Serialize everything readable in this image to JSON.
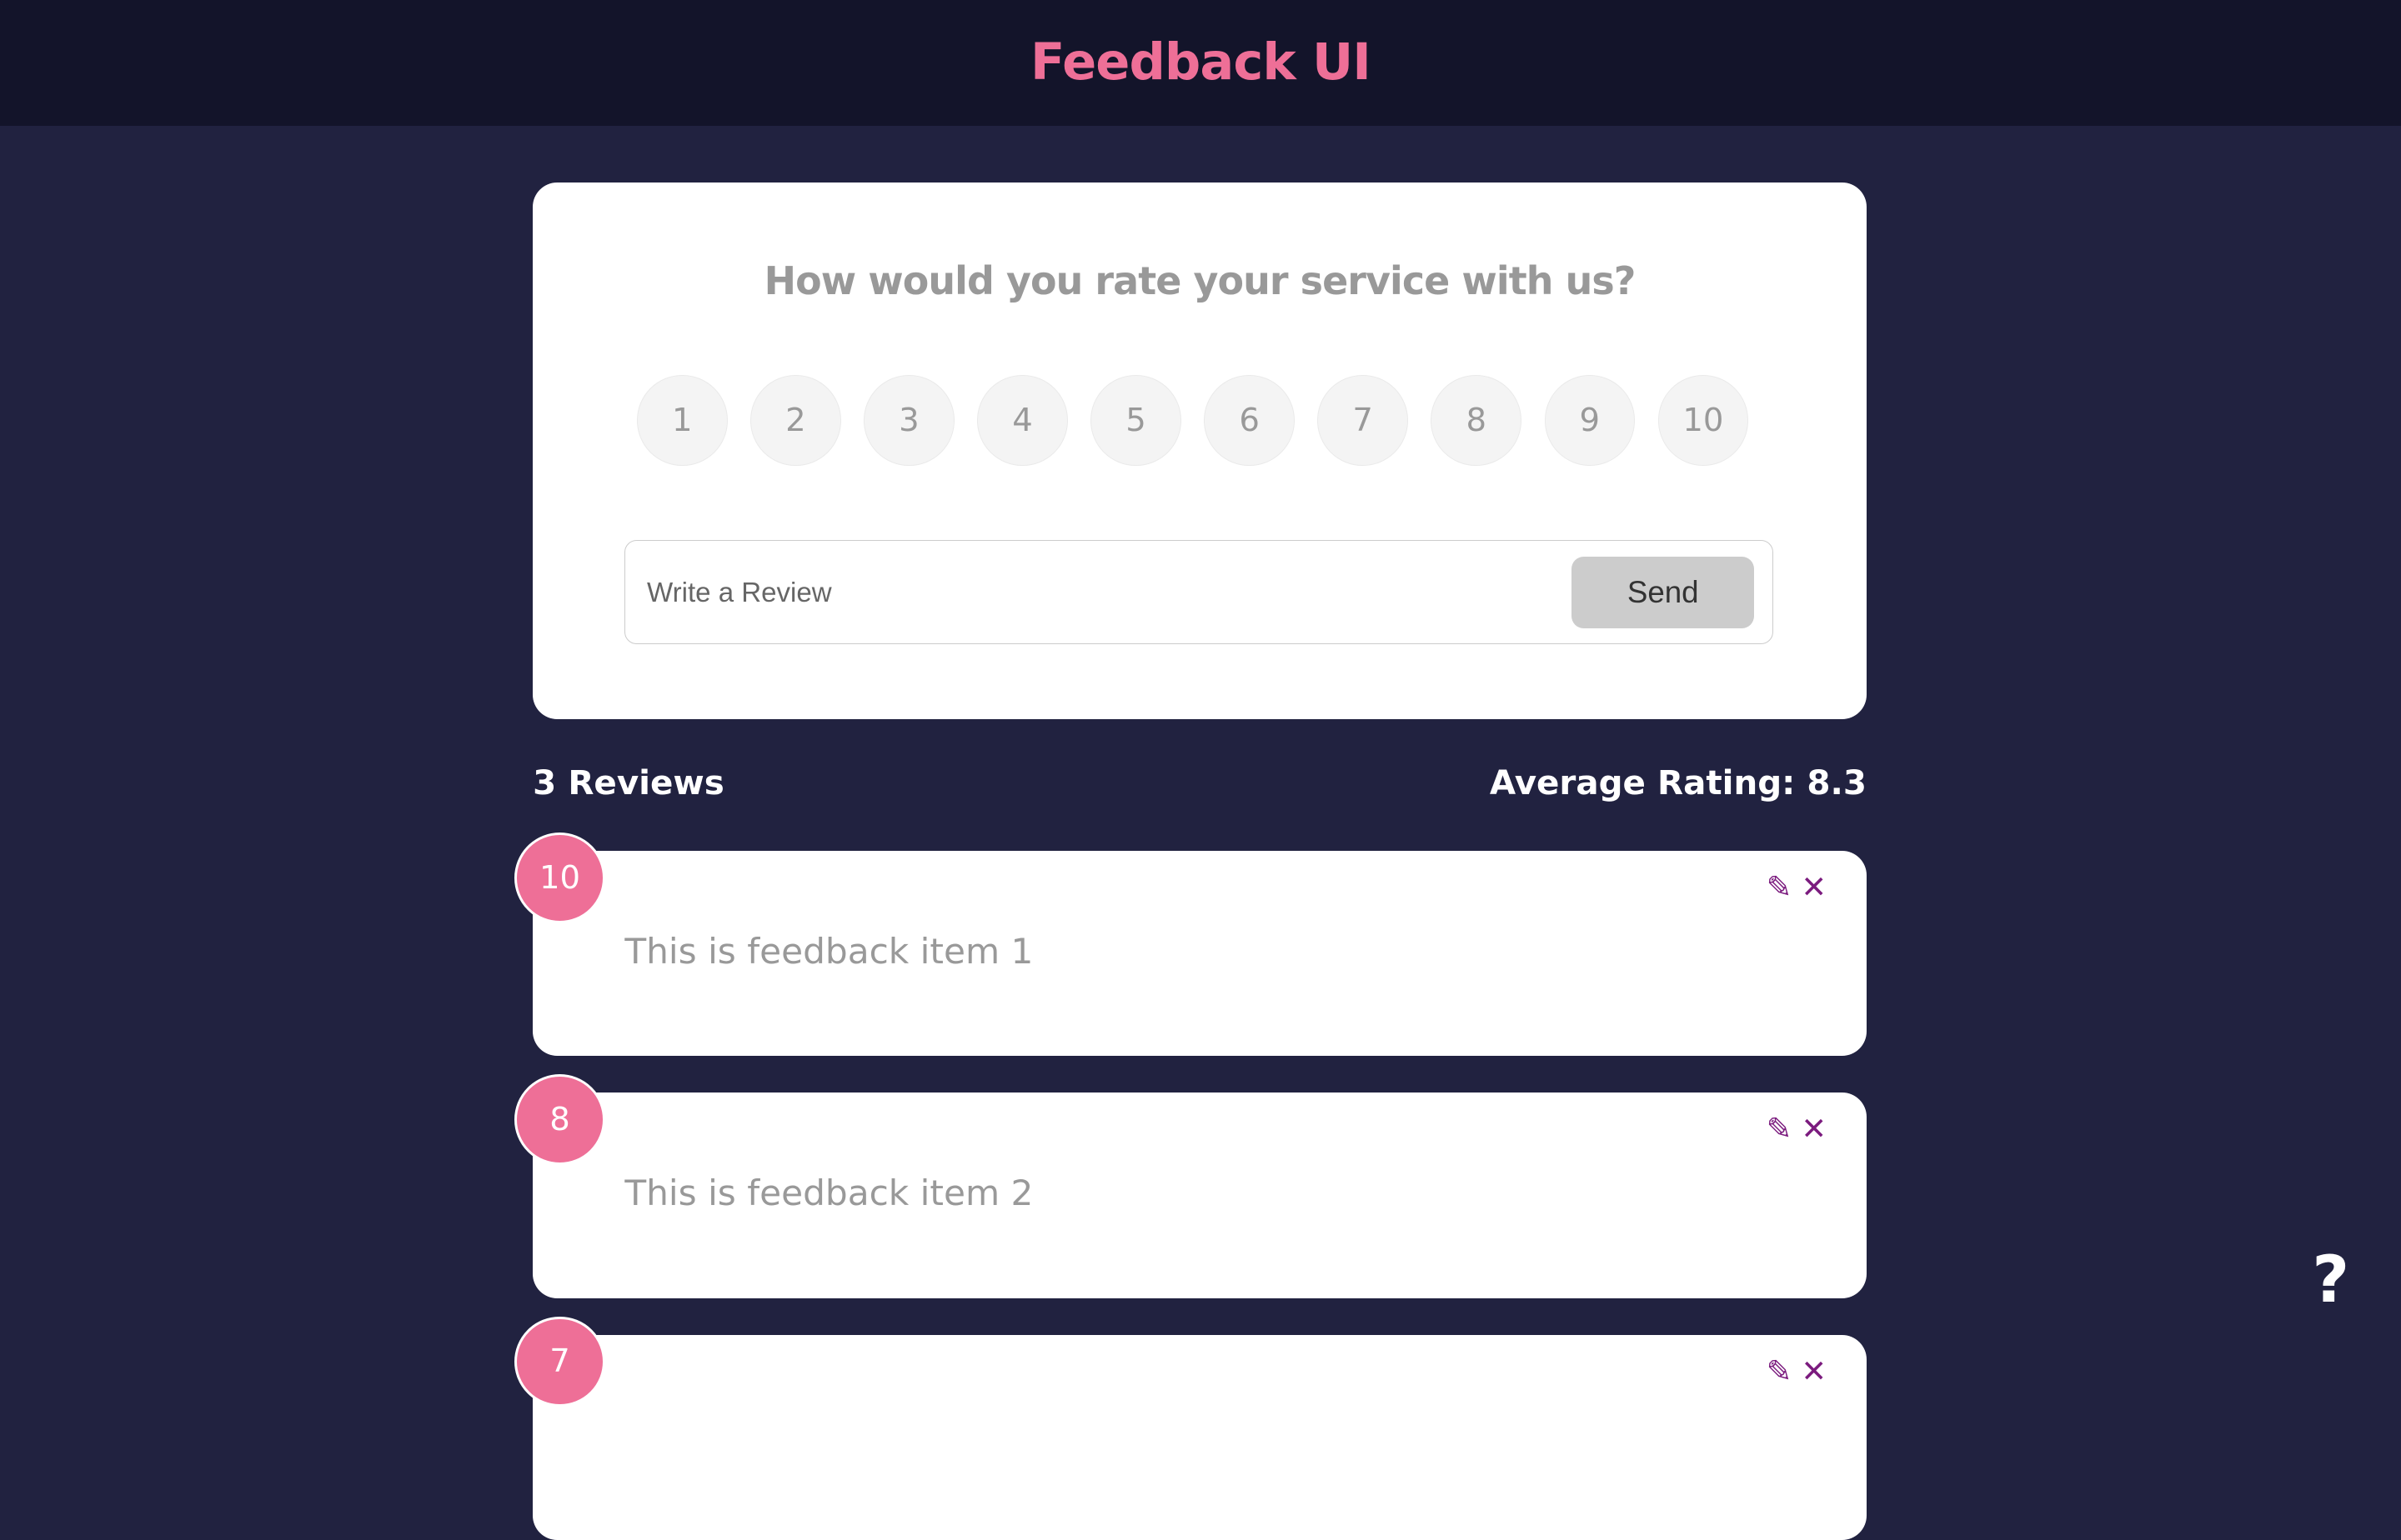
{
  "header": {
    "title": "Feedback UI"
  },
  "form": {
    "question": "How would you rate your service with us?",
    "ratings": [
      "1",
      "2",
      "3",
      "4",
      "5",
      "6",
      "7",
      "8",
      "9",
      "10"
    ],
    "input_placeholder": "Write a Review",
    "input_value": "",
    "send_label": "Send"
  },
  "stats": {
    "count": "3 Reviews",
    "average": "Average Rating: 8.3"
  },
  "feedback": [
    {
      "rating": "10",
      "text": "This is feedback item 1"
    },
    {
      "rating": "8",
      "text": "This is feedback item 2"
    },
    {
      "rating": "7",
      "text": ""
    }
  ],
  "icons": {
    "edit": "edit-icon",
    "delete": "close-icon",
    "help": "?"
  },
  "colors": {
    "accent": "#ee6f97",
    "background": "#212240",
    "header": "#13142a",
    "icon": "#7b1b7e"
  }
}
